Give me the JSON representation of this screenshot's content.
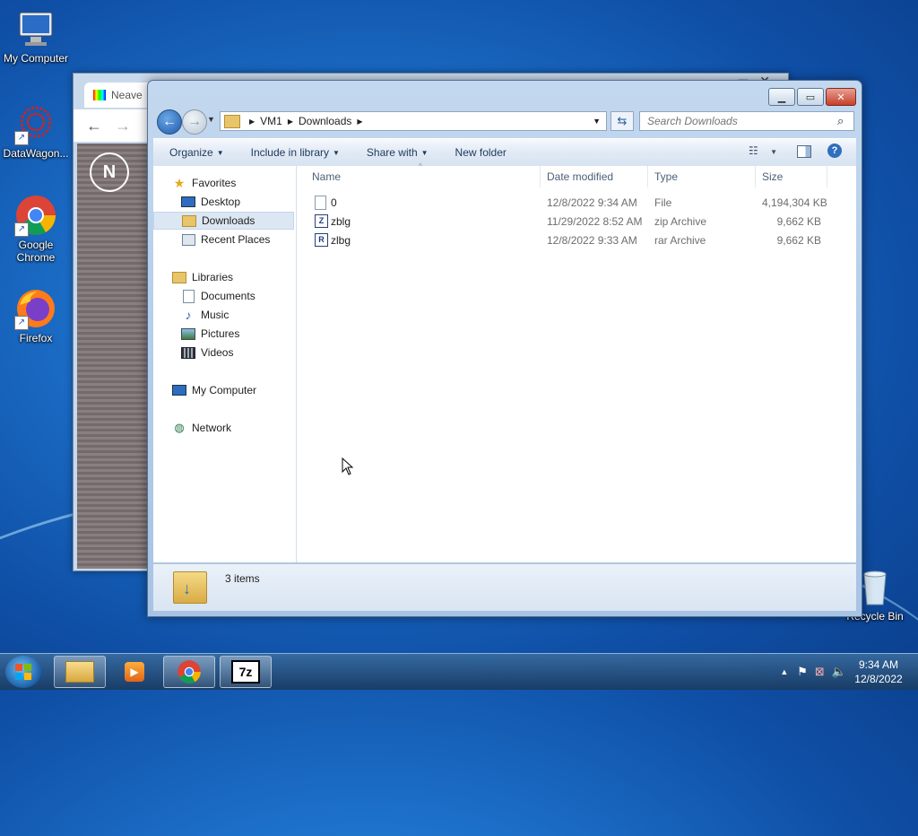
{
  "desktop": {
    "icons": [
      {
        "label": "My Computer"
      },
      {
        "label": "DataWagon..."
      },
      {
        "label": "Google Chrome"
      },
      {
        "label": "Firefox"
      },
      {
        "label": "Recycle Bin"
      }
    ]
  },
  "background_window": {
    "tab_title": "Neave"
  },
  "explorer": {
    "breadcrumb": [
      "VM1",
      "Downloads"
    ],
    "search_placeholder": "Search Downloads",
    "toolbar": {
      "organize": "Organize",
      "include_in_library": "Include in library",
      "share_with": "Share with",
      "new_folder": "New folder"
    },
    "nav": {
      "favorites": "Favorites",
      "desktop": "Desktop",
      "downloads": "Downloads",
      "recent_places": "Recent Places",
      "libraries": "Libraries",
      "documents": "Documents",
      "music": "Music",
      "pictures": "Pictures",
      "videos": "Videos",
      "my_computer": "My Computer",
      "network": "Network"
    },
    "columns": {
      "name": "Name",
      "date_modified": "Date modified",
      "type": "Type",
      "size": "Size"
    },
    "files": [
      {
        "name": "0",
        "date": "12/8/2022 9:34 AM",
        "type": "File",
        "size": "4,194,304 KB",
        "icon": "blank-file-icon"
      },
      {
        "name": "zblg",
        "date": "11/29/2022 8:52 AM",
        "type": "zip Archive",
        "size": "9,662 KB",
        "icon": "zip-archive-icon"
      },
      {
        "name": "zlbg",
        "date": "12/8/2022 9:33 AM",
        "type": "rar Archive",
        "size": "9,662 KB",
        "icon": "rar-archive-icon"
      }
    ],
    "status": "3 items"
  },
  "taskbar": {
    "items": [
      "start",
      "explorer",
      "media-player",
      "chrome",
      "7zip"
    ],
    "sevenzip_label": "7z"
  },
  "clock": {
    "time": "9:34 AM",
    "date": "12/8/2022"
  }
}
